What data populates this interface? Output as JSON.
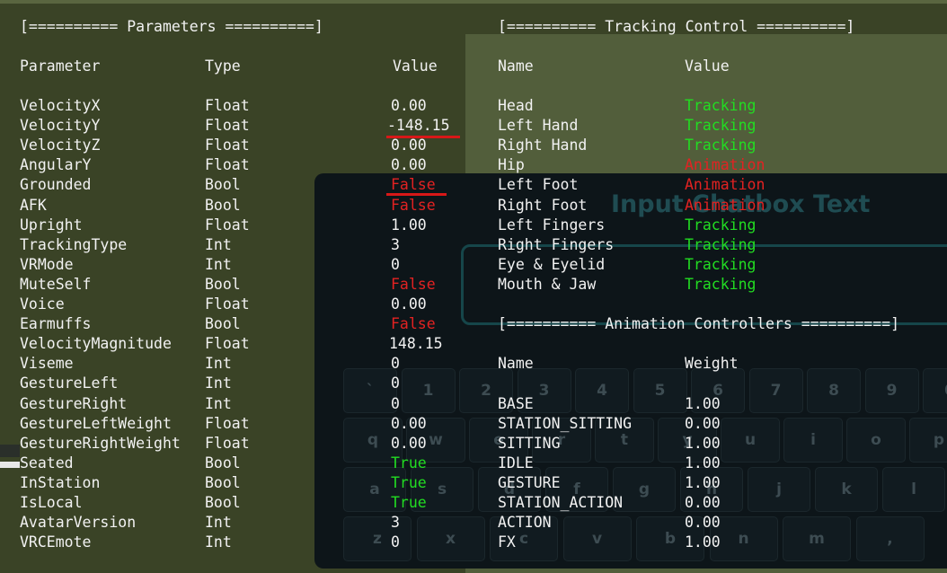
{
  "colors": {
    "true": "#22dd22",
    "false": "#e32222",
    "tracking": "#22dd22",
    "animation": "#e32222"
  },
  "parameters": {
    "title": "[========== Parameters ==========]",
    "headers": [
      "Parameter",
      "Type",
      "Value"
    ],
    "rows": [
      [
        "VelocityX",
        "Float",
        "0.00"
      ],
      [
        "VelocityY",
        "Float",
        "-148.15"
      ],
      [
        "VelocityZ",
        "Float",
        "0.00"
      ],
      [
        "AngularY",
        "Float",
        "0.00"
      ],
      [
        "Grounded",
        "Bool",
        "False"
      ],
      [
        "AFK",
        "Bool",
        "False"
      ],
      [
        "Upright",
        "Float",
        "1.00"
      ],
      [
        "TrackingType",
        "Int",
        "3"
      ],
      [
        "VRMode",
        "Int",
        "0"
      ],
      [
        "MuteSelf",
        "Bool",
        "False"
      ],
      [
        "Voice",
        "Float",
        "0.00"
      ],
      [
        "Earmuffs",
        "Bool",
        "False"
      ],
      [
        "VelocityMagnitude",
        "Float",
        "148.15"
      ],
      [
        "Viseme",
        "Int",
        "0"
      ],
      [
        "GestureLeft",
        "Int",
        "0"
      ],
      [
        "GestureRight",
        "Int",
        "0"
      ],
      [
        "GestureLeftWeight",
        "Float",
        "0.00"
      ],
      [
        "GestureRightWeight",
        "Float",
        "0.00"
      ],
      [
        "Seated",
        "Bool",
        "True"
      ],
      [
        "InStation",
        "Bool",
        "True"
      ],
      [
        "IsLocal",
        "Bool",
        "True"
      ],
      [
        "AvatarVersion",
        "Int",
        "3"
      ],
      [
        "VRCEmote",
        "Int",
        "0"
      ]
    ]
  },
  "tracking": {
    "title": "[========== Tracking Control ==========]",
    "headers": [
      "Name",
      "Value"
    ],
    "rows": [
      [
        "Head",
        "Tracking"
      ],
      [
        "Left Hand",
        "Tracking"
      ],
      [
        "Right Hand",
        "Tracking"
      ],
      [
        "Hip",
        "Animation"
      ],
      [
        "Left Foot",
        "Animation"
      ],
      [
        "Right Foot",
        "Animation"
      ],
      [
        "Left Fingers",
        "Tracking"
      ],
      [
        "Right Fingers",
        "Tracking"
      ],
      [
        "Eye & Eyelid",
        "Tracking"
      ],
      [
        "Mouth & Jaw",
        "Tracking"
      ]
    ]
  },
  "animation": {
    "title": "[========== Animation Controllers ==========]",
    "headers": [
      "Name",
      "Weight"
    ],
    "rows": [
      [
        "BASE",
        "1.00"
      ],
      [
        "STATION_SITTING",
        "0.00"
      ],
      [
        "SITTING",
        "1.00"
      ],
      [
        "IDLE",
        "1.00"
      ],
      [
        "GESTURE",
        "1.00"
      ],
      [
        "STATION_ACTION",
        "0.00"
      ],
      [
        "ACTION",
        "0.00"
      ],
      [
        "FX",
        "1.00"
      ]
    ]
  },
  "chatbox": {
    "placeholder": "Input Chatbox Text"
  },
  "keyboard": {
    "rows": [
      [
        "`",
        "1",
        "2",
        "3",
        "4",
        "5",
        "6",
        "7",
        "8",
        "9",
        "0"
      ],
      [
        "q",
        "w",
        "e",
        "r",
        "t",
        "y",
        "u",
        "i",
        "o",
        "p"
      ],
      [
        "a",
        "s",
        "d",
        "f",
        "g",
        "h",
        "j",
        "k",
        "l"
      ],
      [
        "z",
        "x",
        "c",
        "v",
        "b",
        "n",
        "m",
        ","
      ]
    ]
  }
}
